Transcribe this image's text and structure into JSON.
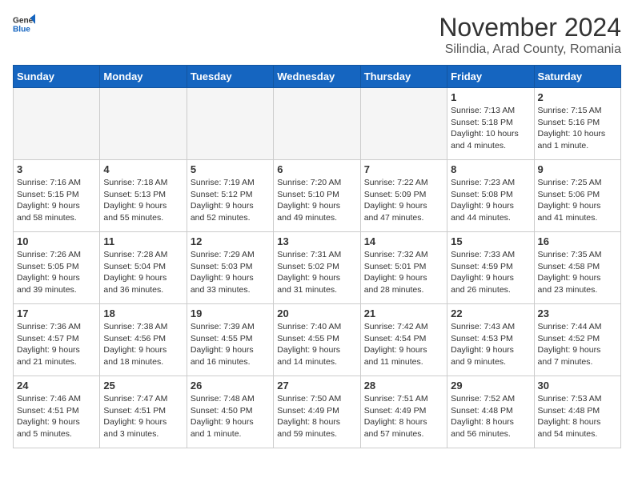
{
  "logo": {
    "line1": "General",
    "line2": "Blue"
  },
  "title": "November 2024",
  "subtitle": "Silindia, Arad County, Romania",
  "days_of_week": [
    "Sunday",
    "Monday",
    "Tuesday",
    "Wednesday",
    "Thursday",
    "Friday",
    "Saturday"
  ],
  "weeks": [
    [
      {
        "day": "",
        "info": ""
      },
      {
        "day": "",
        "info": ""
      },
      {
        "day": "",
        "info": ""
      },
      {
        "day": "",
        "info": ""
      },
      {
        "day": "",
        "info": ""
      },
      {
        "day": "1",
        "info": "Sunrise: 7:13 AM\nSunset: 5:18 PM\nDaylight: 10 hours\nand 4 minutes."
      },
      {
        "day": "2",
        "info": "Sunrise: 7:15 AM\nSunset: 5:16 PM\nDaylight: 10 hours\nand 1 minute."
      }
    ],
    [
      {
        "day": "3",
        "info": "Sunrise: 7:16 AM\nSunset: 5:15 PM\nDaylight: 9 hours\nand 58 minutes."
      },
      {
        "day": "4",
        "info": "Sunrise: 7:18 AM\nSunset: 5:13 PM\nDaylight: 9 hours\nand 55 minutes."
      },
      {
        "day": "5",
        "info": "Sunrise: 7:19 AM\nSunset: 5:12 PM\nDaylight: 9 hours\nand 52 minutes."
      },
      {
        "day": "6",
        "info": "Sunrise: 7:20 AM\nSunset: 5:10 PM\nDaylight: 9 hours\nand 49 minutes."
      },
      {
        "day": "7",
        "info": "Sunrise: 7:22 AM\nSunset: 5:09 PM\nDaylight: 9 hours\nand 47 minutes."
      },
      {
        "day": "8",
        "info": "Sunrise: 7:23 AM\nSunset: 5:08 PM\nDaylight: 9 hours\nand 44 minutes."
      },
      {
        "day": "9",
        "info": "Sunrise: 7:25 AM\nSunset: 5:06 PM\nDaylight: 9 hours\nand 41 minutes."
      }
    ],
    [
      {
        "day": "10",
        "info": "Sunrise: 7:26 AM\nSunset: 5:05 PM\nDaylight: 9 hours\nand 39 minutes."
      },
      {
        "day": "11",
        "info": "Sunrise: 7:28 AM\nSunset: 5:04 PM\nDaylight: 9 hours\nand 36 minutes."
      },
      {
        "day": "12",
        "info": "Sunrise: 7:29 AM\nSunset: 5:03 PM\nDaylight: 9 hours\nand 33 minutes."
      },
      {
        "day": "13",
        "info": "Sunrise: 7:31 AM\nSunset: 5:02 PM\nDaylight: 9 hours\nand 31 minutes."
      },
      {
        "day": "14",
        "info": "Sunrise: 7:32 AM\nSunset: 5:01 PM\nDaylight: 9 hours\nand 28 minutes."
      },
      {
        "day": "15",
        "info": "Sunrise: 7:33 AM\nSunset: 4:59 PM\nDaylight: 9 hours\nand 26 minutes."
      },
      {
        "day": "16",
        "info": "Sunrise: 7:35 AM\nSunset: 4:58 PM\nDaylight: 9 hours\nand 23 minutes."
      }
    ],
    [
      {
        "day": "17",
        "info": "Sunrise: 7:36 AM\nSunset: 4:57 PM\nDaylight: 9 hours\nand 21 minutes."
      },
      {
        "day": "18",
        "info": "Sunrise: 7:38 AM\nSunset: 4:56 PM\nDaylight: 9 hours\nand 18 minutes."
      },
      {
        "day": "19",
        "info": "Sunrise: 7:39 AM\nSunset: 4:55 PM\nDaylight: 9 hours\nand 16 minutes."
      },
      {
        "day": "20",
        "info": "Sunrise: 7:40 AM\nSunset: 4:55 PM\nDaylight: 9 hours\nand 14 minutes."
      },
      {
        "day": "21",
        "info": "Sunrise: 7:42 AM\nSunset: 4:54 PM\nDaylight: 9 hours\nand 11 minutes."
      },
      {
        "day": "22",
        "info": "Sunrise: 7:43 AM\nSunset: 4:53 PM\nDaylight: 9 hours\nand 9 minutes."
      },
      {
        "day": "23",
        "info": "Sunrise: 7:44 AM\nSunset: 4:52 PM\nDaylight: 9 hours\nand 7 minutes."
      }
    ],
    [
      {
        "day": "24",
        "info": "Sunrise: 7:46 AM\nSunset: 4:51 PM\nDaylight: 9 hours\nand 5 minutes."
      },
      {
        "day": "25",
        "info": "Sunrise: 7:47 AM\nSunset: 4:51 PM\nDaylight: 9 hours\nand 3 minutes."
      },
      {
        "day": "26",
        "info": "Sunrise: 7:48 AM\nSunset: 4:50 PM\nDaylight: 9 hours\nand 1 minute."
      },
      {
        "day": "27",
        "info": "Sunrise: 7:50 AM\nSunset: 4:49 PM\nDaylight: 8 hours\nand 59 minutes."
      },
      {
        "day": "28",
        "info": "Sunrise: 7:51 AM\nSunset: 4:49 PM\nDaylight: 8 hours\nand 57 minutes."
      },
      {
        "day": "29",
        "info": "Sunrise: 7:52 AM\nSunset: 4:48 PM\nDaylight: 8 hours\nand 56 minutes."
      },
      {
        "day": "30",
        "info": "Sunrise: 7:53 AM\nSunset: 4:48 PM\nDaylight: 8 hours\nand 54 minutes."
      }
    ]
  ]
}
